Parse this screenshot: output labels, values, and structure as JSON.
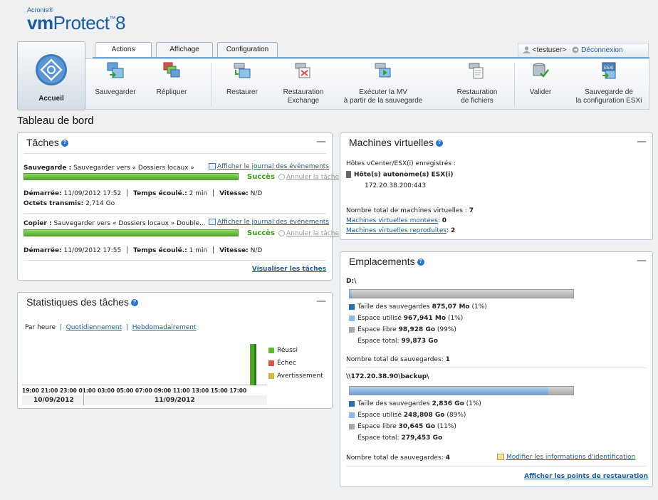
{
  "header": {
    "brand_small": "Acronis®",
    "brand_bold": "vm",
    "brand_rest": "Protect",
    "brand_version": "8",
    "brand_tm": "™"
  },
  "tabs": [
    {
      "label": "Actions"
    },
    {
      "label": "Affichage"
    },
    {
      "label": "Configuration"
    }
  ],
  "user": {
    "name": "<testuser>",
    "logout": "Déconnexion"
  },
  "toolbar": {
    "home_label": "Accueil",
    "buttons": [
      {
        "l1": "Sauvegarder",
        "l2": ""
      },
      {
        "l1": "Répliquer",
        "l2": ""
      },
      {
        "l1": "Restaurer",
        "l2": ""
      },
      {
        "l1": "Restauration",
        "l2": "Exchange"
      },
      {
        "l1": "Exécuter la MV",
        "l2": "à partir de la sauvegarde"
      },
      {
        "l1": "Restauration",
        "l2": "de fichiers"
      },
      {
        "l1": "Valider",
        "l2": ""
      },
      {
        "l1": "Sauvegarde de",
        "l2": "la configuration ESXi"
      }
    ]
  },
  "page_title": "Tableau de bord",
  "tasks": {
    "title": "Tâches",
    "items": [
      {
        "label": "Sauvegarde :",
        "desc": "Sauvegarder vers « Dossiers locaux »",
        "log_link": "Afficher le journal des événements",
        "progress": 1.0,
        "status": "Succès",
        "cancel": "Annuler la tâche",
        "started_label": "Démarrée:",
        "started": "11/09/2012 17:52",
        "elapsed_label": "Temps écoulé.:",
        "elapsed": "2 min",
        "speed_label": "Vitesse:",
        "speed": "N/D",
        "bytes_label": "Octets transmis:",
        "bytes": "2,714 Go"
      },
      {
        "label": "Copier :",
        "desc": "Sauvegarder vers « Dossiers locaux » Double...",
        "log_link": "Afficher le journal des événements",
        "progress": 1.0,
        "status": "Succès",
        "cancel": "Annuler la tâche",
        "started_label": "Démarrée:",
        "started": "11/09/2012 17:55",
        "elapsed_label": "Temps écoulé.:",
        "elapsed": "1 min",
        "speed_label": "Vitesse:",
        "speed": "N/D"
      }
    ],
    "view_all": "Visualiser les tâches"
  },
  "stats": {
    "title": "Statistiques des tâches",
    "periods": [
      "Par heure",
      "Quotidiennement",
      "Hebdomadairement"
    ],
    "legend": [
      {
        "label": "Réussi",
        "color": "#5cb82e"
      },
      {
        "label": "Échec",
        "color": "#d9534f"
      },
      {
        "label": "Avertissement",
        "color": "#d4b43a"
      }
    ],
    "hours": "19:00 21:00 23:00 01:00 03:00 05:00 07:00 09:00 11:00 13:00 15:00 17:00",
    "date1": "10/09/2012",
    "date2": "11/09/2012"
  },
  "vms": {
    "title": "Machines virtuelles",
    "hosts_label": "Hôtes vCenter/ESX(i) enregistrés :",
    "host_group": "Hôte(s) autonome(s) ESX(i)",
    "host_ip": "172.20.38.200:443",
    "total_label": "Nombre total de machines virtuelles :",
    "total": "7",
    "mounted_label": "Machines virtuelles montées",
    "mounted": "0",
    "replicated_label": "Machines virtuelles reproduites",
    "replicated": "2"
  },
  "locations": {
    "title": "Emplacements",
    "items": [
      {
        "name": "D:\\",
        "used_fraction": 0.01,
        "backup_size_label": "Taille des sauvegardes",
        "backup_size": "875,07 Mo",
        "backup_size_pct": "(1%)",
        "used_label": "Espace utilisé",
        "used": "967,941 Mo",
        "used_pct": "(1%)",
        "free_label": "Espace libre",
        "free": "98,928 Go",
        "free_pct": "(99%)",
        "total_label": "Espace total:",
        "total": "99,873 Go",
        "count_label": "Nombre total de sauvegardes:",
        "count": "1"
      },
      {
        "name": "\\\\172.20.38.90\\backup\\",
        "used_fraction": 0.89,
        "backup_size_label": "Taille des sauvegardes",
        "backup_size": "2,836 Go",
        "backup_size_pct": "(1%)",
        "used_label": "Espace utilisé",
        "used": "248,808 Go",
        "used_pct": "(89%)",
        "free_label": "Espace libre",
        "free": "30,645 Go",
        "free_pct": "(11%)",
        "total_label": "Espace total:",
        "total": "279,453 Go",
        "count_label": "Nombre total de sauvegardes:",
        "count": "4",
        "edit_link": "Modifier les informations d'identification"
      }
    ],
    "restore_points": "Afficher les points de restauration"
  },
  "colors": {
    "backup": "#2f6fb0",
    "used": "#8fb8e0",
    "free": "#a8a8a8",
    "success": "#3c9a1a"
  }
}
